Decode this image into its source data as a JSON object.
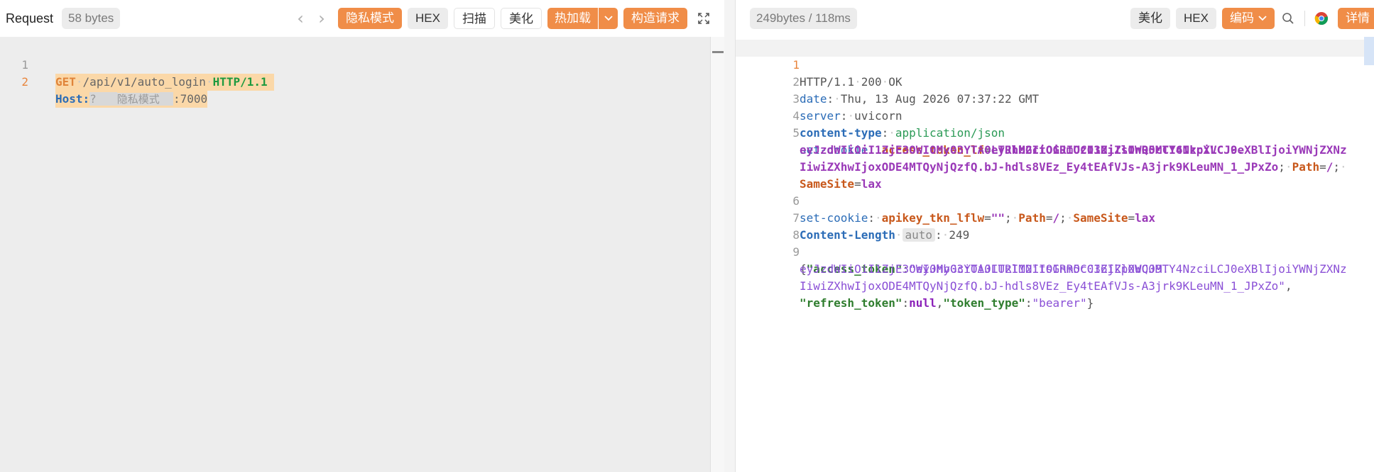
{
  "request": {
    "title": "Request",
    "size": "58 bytes",
    "toolbar": {
      "privacy_label": "隐私模式",
      "hex_label": "HEX",
      "scan_label": "扫描",
      "beautify_label": "美化",
      "hotload_label": "热加载",
      "construct_label": "构造请求"
    },
    "lines": [
      {
        "num": "1",
        "method": "GET",
        "path": "/api/v1/auto_login",
        "proto": "HTTP/1.1"
      },
      {
        "num": "2",
        "header": "Host:",
        "q": "?",
        "masked": "隐私模式",
        "port": ":7000"
      }
    ]
  },
  "response": {
    "size": "249bytes / 118ms",
    "toolbar": {
      "beautify_label": "美化",
      "hex_label": "HEX",
      "encoding_label": "编码",
      "details_label": "详情"
    },
    "lines": {
      "l1": {
        "num": "1",
        "a": "HTTP/1.1",
        "b": "200",
        "c": "OK"
      },
      "l2": {
        "num": "2",
        "key": "date",
        "val": "Thu, 13 Aug 2026 07:37:22 GMT"
      },
      "l3": {
        "num": "3",
        "key": "server",
        "val": "uvicorn"
      },
      "l4": {
        "num": "4",
        "key": "content-type",
        "val": "application/json"
      },
      "l5": {
        "num": "5",
        "key": "set-cookie",
        "cname": "access_token_lf",
        "cval1": "eyJhbGciOiJIUzI1NiIsInR5cCI6IkpXVCJ9.",
        "cval2": "eyJzdWIiOiI1ZjE3OWI0My03YTA0LTRlM2ItOGRmOC03ZjZlOWQ0MTY4NzciLCJ0eXBlIjoiYWNjZXNz",
        "cval3": "IiwiZXhwIjoxODE4MTQyNjQzfQ.bJ-hdls8VEz_Ey4tEAfVJs-A3jrk9KLeuMN_1_JPxZo",
        "path": "Path",
        "path_val": "/",
        "samesite": "SameSite",
        "samesite_val": "lax"
      },
      "l6": {
        "num": "6",
        "key": "set-cookie",
        "cname": "apikey_tkn_lflw",
        "cval": "\"\"",
        "path": "Path",
        "path_val": "/",
        "samesite": "SameSite",
        "samesite_val": "lax"
      },
      "l7": {
        "num": "7",
        "key": "Content-Length",
        "badge": "auto",
        "val": "249"
      },
      "l8": {
        "num": "8"
      },
      "l9": {
        "num": "9",
        "k1": "\"access_token\"",
        "v1a": "\"eyJhbGciOiJIUzI1NiIsInR5cCI6IkpXVCJ9.",
        "v1b": "eyJzdWIiOiI1ZjE3OWI0My03YTA0LTRlM2ItOGRmOC03ZjZlOWQ0MTY4NzciLCJ0eXBlIjoiYWNjZXNz",
        "v1c": "IiwiZXhwIjoxODE4MTQyNjQzfQ.bJ-hdls8VEz_Ey4tEAfVJs-A3jrk9KLeuMN_1_JPxZo\"",
        "k2": "\"refresh_token\"",
        "v2": "null",
        "k3": "\"token_type\"",
        "v3": "\"bearer\""
      }
    }
  },
  "colors": {
    "accent": "#f08d48",
    "line_number_active": "#e8853c"
  },
  "icons": [
    "chevron-left-icon",
    "chevron-right-icon",
    "chevron-down-icon",
    "fullscreen-icon",
    "search-icon",
    "chrome-icon"
  ]
}
